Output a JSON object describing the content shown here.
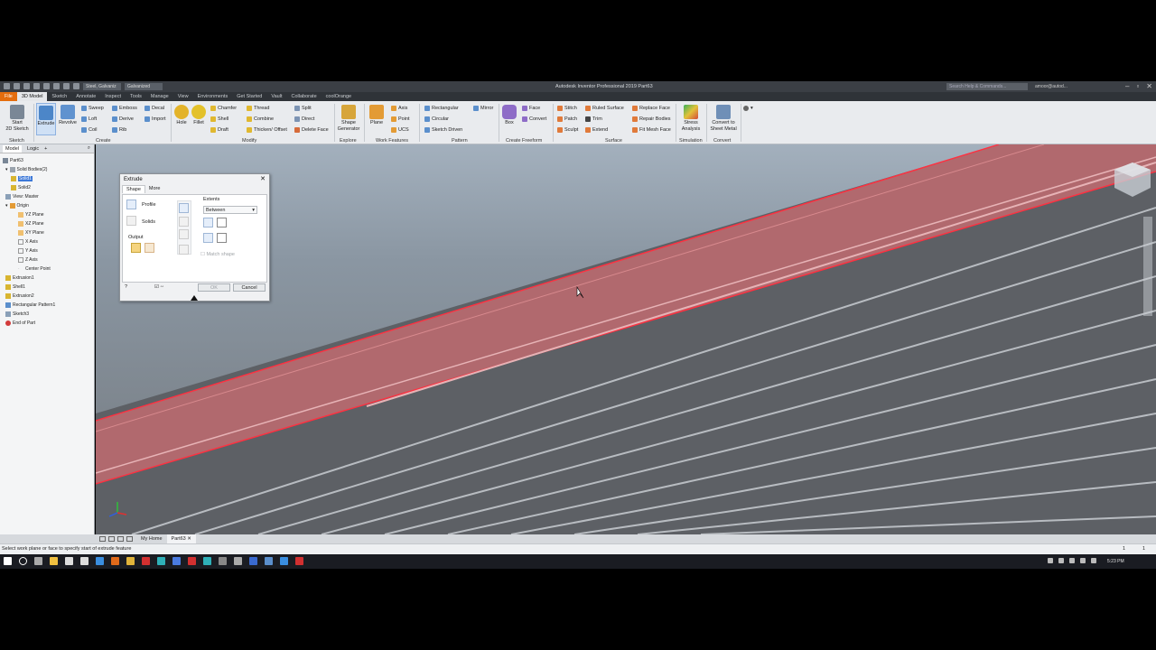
{
  "window": {
    "title": "Autodesk Inventor Professional 2019   Part63",
    "material": "Steel, Galvaniz",
    "appearance": "Galvanized",
    "search_placeholder": "Search Help & Commands...",
    "user": "amoor@autod..."
  },
  "ribbon_tabs": [
    "File",
    "3D Model",
    "Sketch",
    "Annotate",
    "Inspect",
    "Tools",
    "Manage",
    "View",
    "Environments",
    "Get Started",
    "Vault",
    "Collaborate",
    "coolOrange"
  ],
  "ribbon": {
    "sketch": {
      "start": "Start",
      "start2": "2D Sketch",
      "group": "Sketch"
    },
    "create": {
      "extrude": "Extrude",
      "revolve": "Revolve",
      "sweep": "Sweep",
      "loft": "Loft",
      "coil": "Coil",
      "emboss": "Emboss",
      "derive": "Derive",
      "rib": "Rib",
      "decal": "Decal",
      "import": "Import",
      "group": "Create"
    },
    "modify": {
      "hole": "Hole",
      "fillet": "Fillet",
      "chamfer": "Chamfer",
      "shell": "Shell",
      "draft": "Draft",
      "thread": "Thread",
      "combine": "Combine",
      "thicken": "Thicken/ Offset",
      "split": "Split",
      "direct": "Direct",
      "delete_face": "Delete Face",
      "group": "Modify"
    },
    "explore": {
      "shape_gen": "Shape",
      "shape_gen2": "Generator",
      "group": "Explore"
    },
    "work": {
      "plane": "Plane",
      "axis": "Axis",
      "point": "Point",
      "ucs": "UCS",
      "group": "Work Features"
    },
    "pattern": {
      "rectangular": "Rectangular",
      "circular": "Circular",
      "sketch_driven": "Sketch Driven",
      "mirror": "Mirror",
      "group": "Pattern"
    },
    "freeform": {
      "box": "Box",
      "face": "Face",
      "convert": "Convert",
      "group": "Create Freeform"
    },
    "surface": {
      "stitch": "Stitch",
      "patch": "Patch",
      "sculpt": "Sculpt",
      "ruled": "Ruled Surface",
      "trim": "Trim",
      "extend": "Extend",
      "replace": "Replace Face",
      "repair": "Repair Bodies",
      "fitmesh": "Fit Mesh Face",
      "group": "Surface"
    },
    "simulation": {
      "stress": "Stress",
      "stress2": "Analysis",
      "group": "Simulation"
    },
    "convert": {
      "sheet": "Convert to",
      "sheet2": "Sheet Metal",
      "group": "Convert"
    }
  },
  "browser": {
    "tab_model": "Model",
    "tab_logic": "Logic",
    "items": [
      "Part63",
      "Solid Bodies(2)",
      "Solid1",
      "Solid2",
      "View: Master",
      "Origin",
      "YZ Plane",
      "XZ Plane",
      "XY Plane",
      "X Axis",
      "Y Axis",
      "Z Axis",
      "Center Point",
      "Extrusion1",
      "Shell1",
      "Extrusion2",
      "Rectangular Pattern1",
      "Sketch3",
      "End of Part"
    ]
  },
  "dialog": {
    "title": "Extrude",
    "tab_shape": "Shape",
    "tab_more": "More",
    "profile": "Profile",
    "solids": "Solids",
    "output": "Output",
    "extents": "Extents",
    "extents_value": "Between",
    "match_shape": "Match shape",
    "ok": "OK",
    "cancel": "Cancel"
  },
  "doc_tabs": {
    "home": "My Home",
    "part": "Part63"
  },
  "status": {
    "message": "Select work plane or face to specify start of extrude feature",
    "n1": "1",
    "n2": "1"
  },
  "taskbar": {
    "time": "5:23 PM"
  },
  "colors": {
    "accent": "#e46d0e",
    "highlight": "#d62d3a",
    "selection": "#3c78d8"
  }
}
